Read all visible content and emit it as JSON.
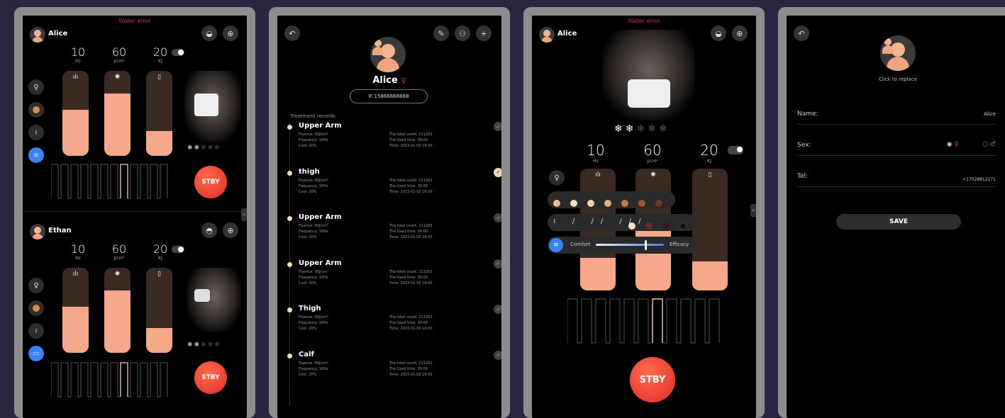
{
  "warning": "Water error",
  "p1": {
    "user1": "Alice",
    "user2": "Ethan",
    "m1": [
      {
        "v": "10",
        "u": "Hz"
      },
      {
        "v": "60",
        "u": "J/cm²"
      },
      {
        "v": "20",
        "u": "KJ"
      }
    ],
    "fills1": [
      0.54,
      0.73,
      0.29
    ],
    "fills2": [
      0.54,
      0.73,
      0.29
    ],
    "stby": "STBY"
  },
  "p2": {
    "name": "Alice",
    "phone": "15866668888",
    "section": "Treatment records",
    "records": [
      {
        "title": "Upper Arm",
        "fl": "Fluence: 60J/cm²",
        "fr": "Frequency: 10Hz",
        "co": "Cool: 20%",
        "tc": "The total count: 211202",
        "ut": "The Used time: 30:00",
        "tm": "Time: 2023-01-03 16:00"
      },
      {
        "title": "thigh",
        "fl": "Fluence: 60J/cm²",
        "fr": "Frequency: 10Hz",
        "co": "Cool: 20%",
        "tc": "The total count: 211202",
        "ut": "The Used time: 30:00",
        "tm": "Time: 2023-01-03 16:00"
      },
      {
        "title": "Upper Arm",
        "fl": "Fluence: 60J/cm²",
        "fr": "Frequency: 10Hz",
        "co": "Cool: 20%",
        "tc": "The total count: 211202",
        "ut": "The Used time: 30:00",
        "tm": "Time: 2023-01-03 16:00"
      },
      {
        "title": "Upper Arm",
        "fl": "Fluence: 60J/cm²",
        "fr": "Frequency: 10Hz",
        "co": "Cool: 20%",
        "tc": "The total count: 211202",
        "ut": "The Used time: 30:00",
        "tm": "Time: 2023-01-03 16:00"
      },
      {
        "title": "Thigh",
        "fl": "Fluence: 60J/cm²",
        "fr": "Frequency: 10Hz",
        "co": "Cool: 20%",
        "tc": "The total count: 211202",
        "ut": "The Used time: 30:00",
        "tm": "Time: 2023-01-03 16:00"
      },
      {
        "title": "Calf",
        "fl": "Fluence: 60J/cm²",
        "fr": "Frequency: 10Hz",
        "co": "Cool: 20%",
        "tc": "The total count: 211202",
        "ut": "The Used time: 30:00",
        "tm": "Time: 2023-01-03 16:00"
      }
    ]
  },
  "p3": {
    "user": "Alice",
    "comfort": "Comfort",
    "efficacy": "Efficacy",
    "stby": "STBY",
    "fills": [
      0.27,
      0.62,
      0.24
    ],
    "slider": 0.72
  },
  "p4": {
    "replace": "Click to replace",
    "name_label": "Name:",
    "name_value": "Alice",
    "sex_label": "Sex:",
    "tel_label": "Tel:",
    "tel_value": "+17028812171",
    "save": "SAVE"
  },
  "colors": {
    "accent": "#f6a98a",
    "stby": "#e8332f",
    "select": "#3b82f6"
  }
}
